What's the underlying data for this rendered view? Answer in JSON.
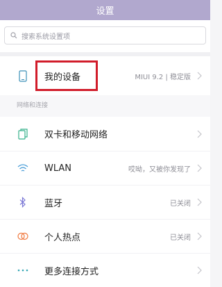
{
  "header": {
    "title": "设置"
  },
  "search": {
    "placeholder": "搜索系统设置项"
  },
  "device": {
    "label": "我的设备",
    "meta": "MIUI 9.2 | 稳定版"
  },
  "network": {
    "section_title": "网络和连接",
    "items": [
      {
        "label": "双卡和移动网络",
        "meta": "",
        "icon": "sim-card-icon"
      },
      {
        "label": "WLAN",
        "meta": "哎呦，又被你发现了",
        "icon": "wifi-icon"
      },
      {
        "label": "蓝牙",
        "meta": "已关闭",
        "icon": "bluetooth-icon"
      },
      {
        "label": "个人热点",
        "meta": "已关闭",
        "icon": "hotspot-icon"
      },
      {
        "label": "更多连接方式",
        "meta": "",
        "icon": "more-dots-icon"
      }
    ]
  }
}
